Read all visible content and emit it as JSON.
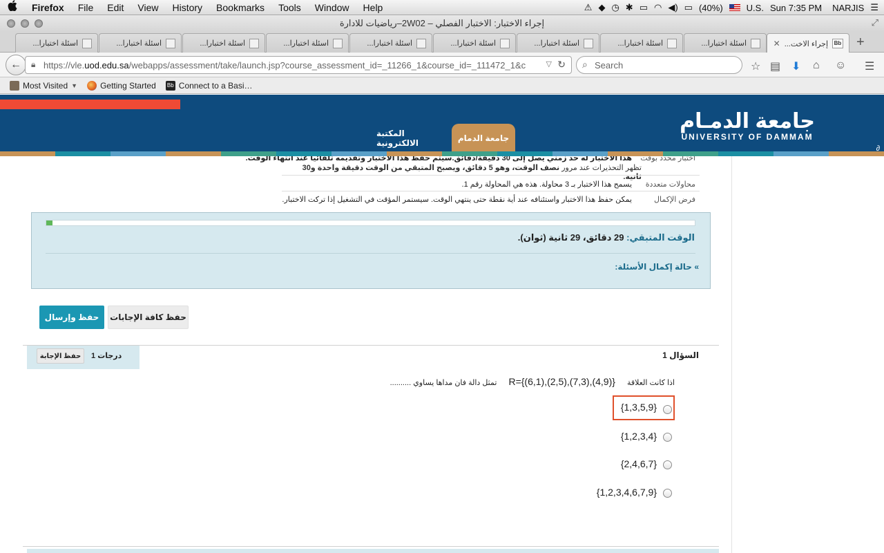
{
  "menubar": {
    "apple": "",
    "items": [
      "Firefox",
      "File",
      "Edit",
      "View",
      "History",
      "Bookmarks",
      "Tools",
      "Window",
      "Help"
    ],
    "battery": "(40%)",
    "input_source": "U.S.",
    "clock": "Sun 7:35 PM",
    "user": "NARJIS"
  },
  "window": {
    "title": "إجراء الاختبار: الاختبار الفصلي – 2W02–رياضيات للادارة"
  },
  "tabs": [
    {
      "label": "...اسئلة اختبارا"
    },
    {
      "label": "...اسئلة اختبارا"
    },
    {
      "label": "...اسئلة اختبارا"
    },
    {
      "label": "...اسئلة اختبارا"
    },
    {
      "label": "...اسئلة اختبارا"
    },
    {
      "label": "...اسئلة اختبارا"
    },
    {
      "label": "...اسئلة اختبارا"
    },
    {
      "label": "...اسئلة اختبارا"
    },
    {
      "label": "...اسئلة اختبارا"
    },
    {
      "label": "...إجراء الاخت",
      "icon": "Bb"
    }
  ],
  "navbar": {
    "url_prefix": "https://vle.",
    "url_domain": "uod.edu.sa",
    "url_path": "/webapps/assessment/take/launch.jsp?course_assessment_id=_11266_1&course_id=_111472_1&c",
    "search_placeholder": "Search"
  },
  "bookmarks": [
    {
      "label": "Most Visited"
    },
    {
      "label": "Getting Started"
    },
    {
      "label": "Connect to a Basi…"
    }
  ],
  "site": {
    "logo_ar": "جامعة الدمـام",
    "logo_en": "UNIVERSITY OF DAMMAM",
    "nav": [
      {
        "label": "جامعة الدمام",
        "active": true
      },
      {
        "label": "المكتبة الالكترونية",
        "active": false
      }
    ],
    "strip_colors": [
      "#c79356",
      "#1b8fa3",
      "#5aa0c8",
      "#c79356",
      "#3fa08a",
      "#1b8fa3",
      "#5aa0c8",
      "#c79356",
      "#3fa08a",
      "#1b8fa3",
      "#5aa0c8",
      "#c79356",
      "#3fa08a",
      "#1b8fa3",
      "#5aa0c8",
      "#c79356"
    ]
  },
  "instructions": {
    "timed_label": "اختبار محدد بوقت",
    "timed_value_1": "هذا الاختبار له حد زمني يصل إلى 30 دقيقة/دقائق.سيتم حفظ هذا الاختبار وتقديمه تلقائياً عند انتهاء الوقت.",
    "timed_value_2_prefix": "تظهر التحذيرات عند مرور",
    "timed_value_2_bold": "نصف الوقت، وهو 5 دقائق، ويصبح المتبقي من الوقت دقيقة واحدة و30 ثانية.",
    "attempts_label": "محاولات متعددة",
    "attempts_value": "يسمح هذا الاختبار بـ 3 محاولة. هذه هي المحاولة رقم 1.",
    "force_label": "فرض الإكمال",
    "force_value": "يمكن حفظ هذا الاختبار واستئنافه عند أية نقطة حتى ينتهي الوقت. سيستمر المؤقت في التشغيل إذا تركت الاختبار."
  },
  "timer": {
    "progress_fraction": 0.01,
    "remaining_label": "الوقت المتبقي:",
    "remaining_value": "29 دقائق، 29 ثانية (ثوان).",
    "status_toggle": "حالة إكمال الأسئلة:"
  },
  "actions": {
    "save_submit": "حفظ وإرسال",
    "save_all": "حفظ كافة الإجابات"
  },
  "question": {
    "label": "السؤال",
    "number": "1",
    "points": "1 درجات",
    "save_answer": "حفظ الإجابة",
    "text_prefix": "اذا كانت العلاقة",
    "relation": "R={(6,1),(2,5),(7,3),(4,9)}",
    "text_suffix": "تمثل دالة فان مداها يساوي ..........",
    "choices": [
      {
        "text": "{1,3,5,9}",
        "highlighted": true
      },
      {
        "text": "{1,2,3,4}",
        "highlighted": false
      },
      {
        "text": "{2,4,6,7}",
        "highlighted": false
      },
      {
        "text": "{1,2,3,4,6,7,9}",
        "highlighted": false
      }
    ],
    "highlight_color": "#e0502b"
  }
}
